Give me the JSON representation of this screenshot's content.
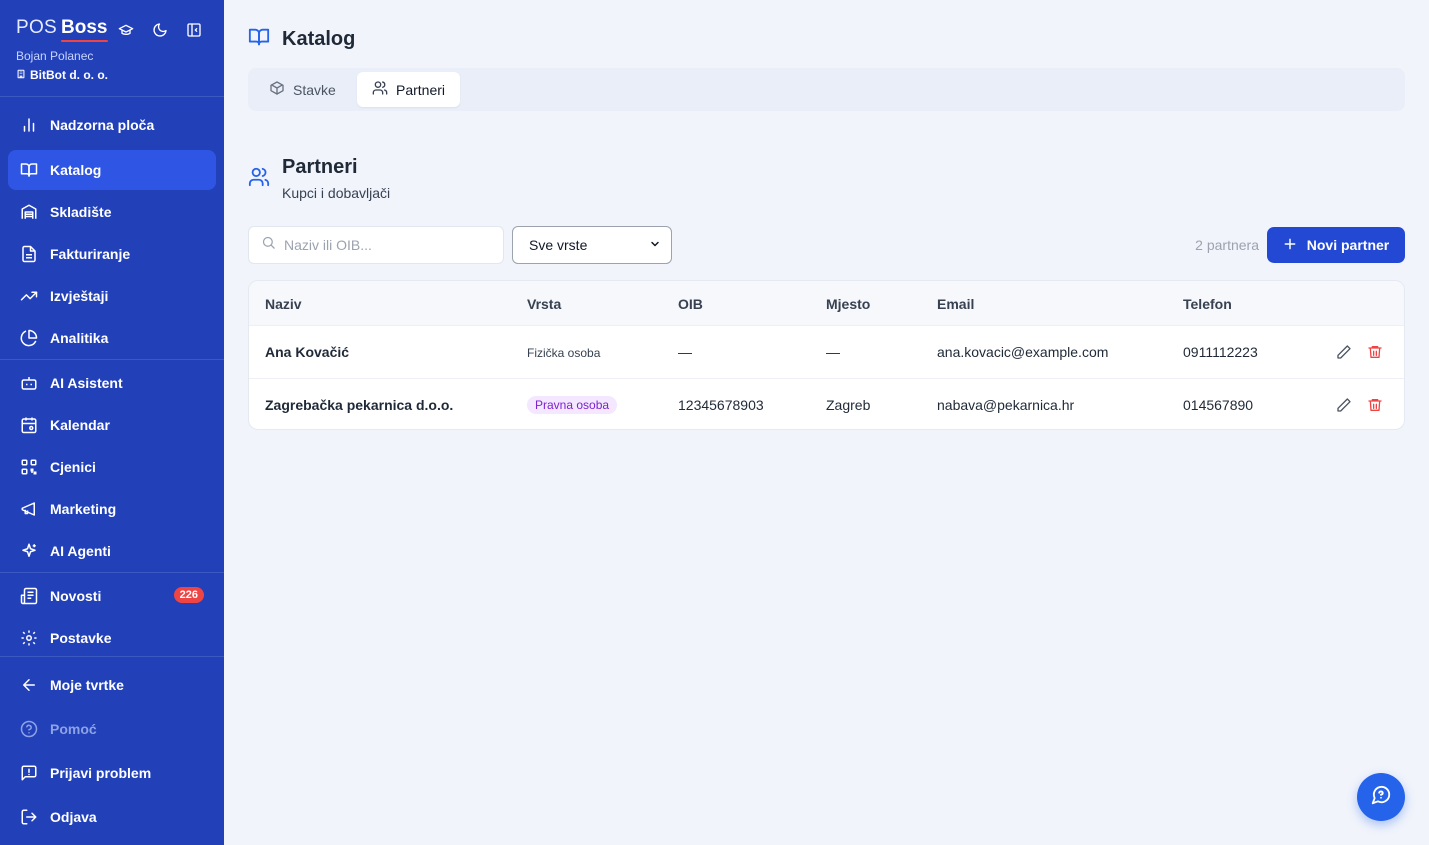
{
  "brand": {
    "pos": "POS",
    "boss": "Boss"
  },
  "user": {
    "name": "Bojan Polanec",
    "company": "BitBot d. o. o."
  },
  "sidebar": {
    "items": [
      {
        "label": "Nadzorna ploča",
        "icon": "bar-chart-icon"
      },
      {
        "label": "Katalog",
        "icon": "book-open-icon",
        "active": true
      },
      {
        "label": "Skladište",
        "icon": "warehouse-icon"
      },
      {
        "label": "Fakturiranje",
        "icon": "file-text-icon"
      },
      {
        "label": "Izvještaji",
        "icon": "trending-up-icon"
      },
      {
        "label": "Analitika",
        "icon": "pie-chart-icon"
      },
      {
        "label": "AI Asistent",
        "icon": "bot-icon"
      },
      {
        "label": "Kalendar",
        "icon": "calendar-icon"
      },
      {
        "label": "Cjenici",
        "icon": "qr-code-icon"
      },
      {
        "label": "Marketing",
        "icon": "megaphone-icon"
      },
      {
        "label": "AI Agenti",
        "icon": "sparkles-icon"
      },
      {
        "label": "Novosti",
        "icon": "newspaper-icon",
        "badge": "226"
      },
      {
        "label": "Postavke",
        "icon": "settings-icon"
      },
      {
        "label": "Moje tvrtke",
        "icon": "arrow-left-icon"
      },
      {
        "label": "Pomoć",
        "icon": "help-circle-icon",
        "disabled": true
      },
      {
        "label": "Prijavi problem",
        "icon": "message-alert-icon"
      },
      {
        "label": "Odjava",
        "icon": "logout-icon"
      }
    ]
  },
  "header": {
    "title": "Katalog"
  },
  "tabs": [
    {
      "label": "Stavke",
      "icon": "package-icon"
    },
    {
      "label": "Partneri",
      "icon": "users-icon",
      "active": true
    }
  ],
  "section": {
    "title": "Partneri",
    "subtitle": "Kupci i dobavljači"
  },
  "toolbar": {
    "search_placeholder": "Naziv ili OIB...",
    "filter_value": "Sve vrste",
    "count_text": "2 partnera",
    "new_button": "Novi partner"
  },
  "table": {
    "columns": [
      "Naziv",
      "Vrsta",
      "OIB",
      "Mjesto",
      "Email",
      "Telefon"
    ],
    "rows": [
      {
        "naziv": "Ana Kovačić",
        "vrsta": "Fizička osoba",
        "oib": "—",
        "mjesto": "—",
        "email": "ana.kovacic@example.com",
        "telefon": "0911112223"
      },
      {
        "naziv": "Zagrebačka pekarnica d.o.o.",
        "vrsta": "Pravna osoba",
        "oib": "12345678903",
        "mjesto": "Zagreb",
        "email": "nabava@pekarnica.hr",
        "telefon": "014567890"
      }
    ]
  },
  "colors": {
    "sidebar": "#2241b9",
    "active": "#2f55e4",
    "accent": "#2348d4",
    "danger": "#ef4444"
  }
}
